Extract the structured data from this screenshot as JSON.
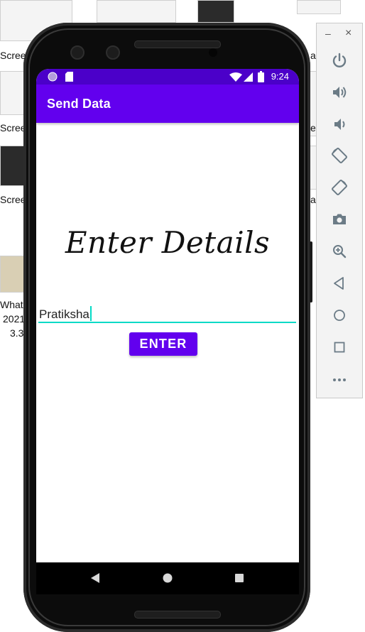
{
  "desktop": {
    "labels": [
      "Scree",
      "Scree",
      "Scree",
      "Whats",
      "2021",
      "3.3"
    ],
    "right_labels": [
      "a",
      "e",
      "a"
    ]
  },
  "emulator_panel": {
    "minimize": "–",
    "close": "×",
    "icons": [
      "power-icon",
      "volume-up-icon",
      "volume-down-icon",
      "rotate-left-icon",
      "rotate-right-icon",
      "camera-icon",
      "zoom-icon",
      "back-icon",
      "home-icon",
      "overview-icon",
      "more-icon"
    ]
  },
  "status_bar": {
    "time": "9:24",
    "icons": [
      "notification-dot-icon",
      "sd-card-icon",
      "wifi-icon",
      "signal-icon",
      "battery-icon"
    ]
  },
  "app_bar": {
    "title": "Send Data"
  },
  "main": {
    "heading": "Enter Details",
    "name_field_value": "Pratiksha",
    "enter_button_label": "ENTER"
  },
  "nav_bar": {
    "icons": [
      "nav-back-icon",
      "nav-home-icon",
      "nav-recents-icon"
    ]
  },
  "colors": {
    "primary": "#6200ee",
    "primary_dark": "#4b00c9",
    "accent": "#03dac6"
  }
}
